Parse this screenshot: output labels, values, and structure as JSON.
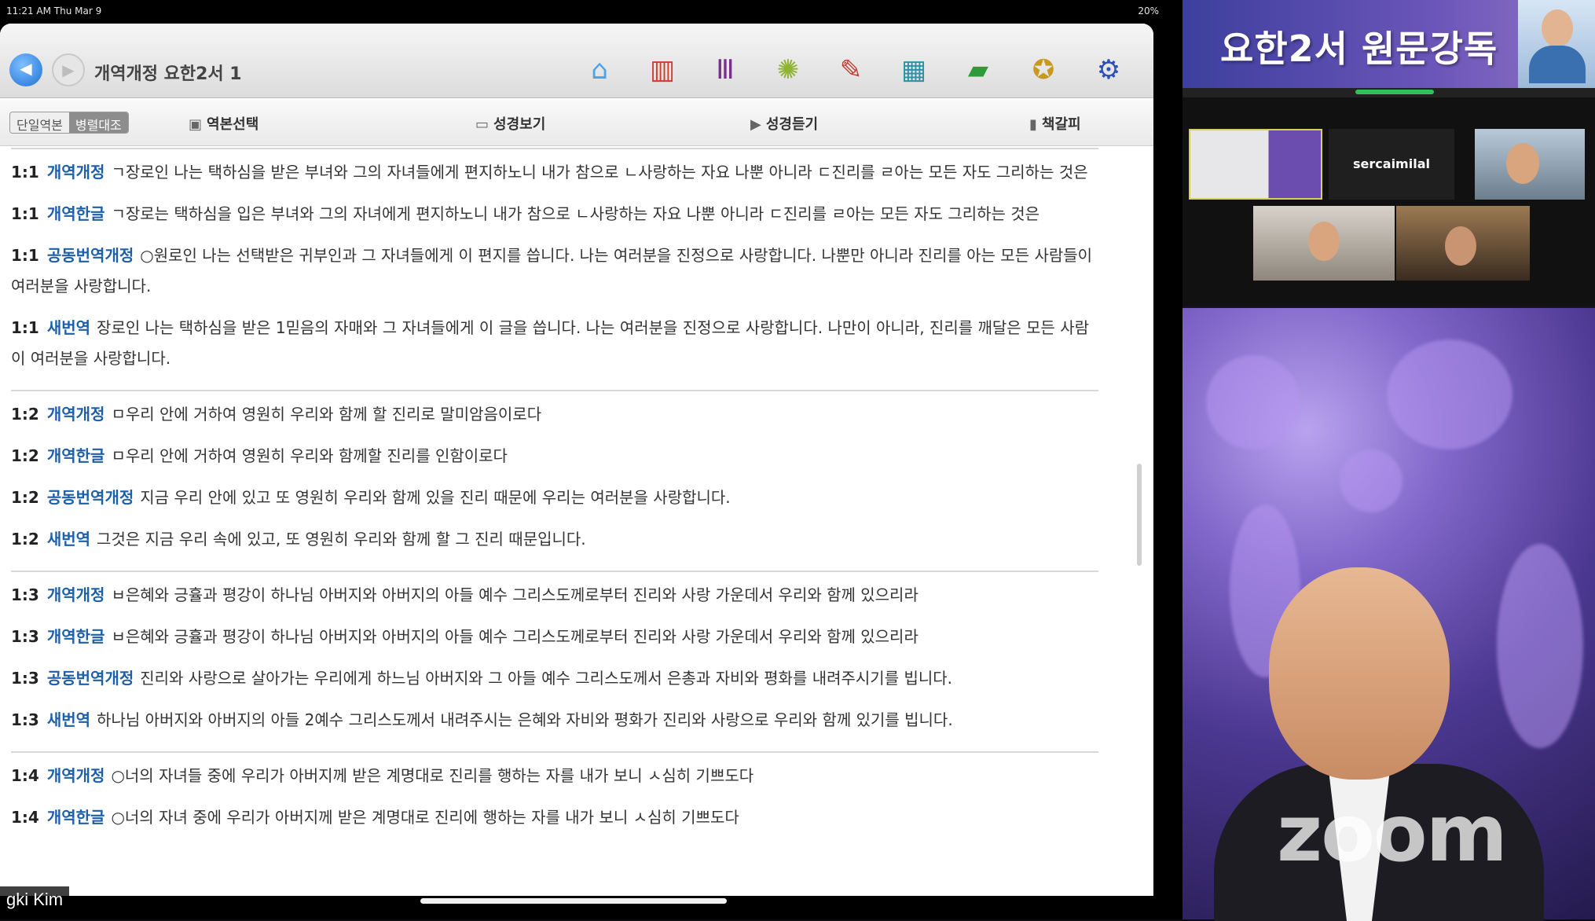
{
  "status_bar": {
    "time": "11:21 AM  Thu Mar 9",
    "right": "20%"
  },
  "app": {
    "title": "개역개정 요한2서 1",
    "toolbar_icons": [
      "home-icon",
      "bible-book-icon",
      "library-icon",
      "star-burst-icon",
      "dove-icon",
      "gallery-icon",
      "notebook-icon",
      "hymn-icon",
      "gear-icon"
    ],
    "segments": [
      "단일역본",
      "병렬대조"
    ],
    "subbar": {
      "version_select": "역본선택",
      "view_bible": "성경보기",
      "listen_bible": "성경듣기",
      "bookmark": "책갈피"
    }
  },
  "verse_groups": [
    [
      {
        "ref": "1:1",
        "version": "개역개정",
        "text": "ㄱ장로인 나는 택하심을 받은 부녀와 그의 자녀들에게 편지하노니 내가 참으로 ㄴ사랑하는 자요 나뿐 아니라 ㄷ진리를 ㄹ아는 모든 자도 그리하는 것은"
      },
      {
        "ref": "1:1",
        "version": "개역한글",
        "text": "ㄱ장로는 택하심을 입은 부녀와 그의 자녀에게 편지하노니 내가 참으로 ㄴ사랑하는 자요 나뿐 아니라 ㄷ진리를 ㄹ아는 모든 자도 그리하는 것은"
      },
      {
        "ref": "1:1",
        "version": "공동번역개정",
        "text": "○원로인 나는 선택받은 귀부인과 그 자녀들에게 이 편지를 씁니다. 나는 여러분을 진정으로 사랑합니다. 나뿐만 아니라 진리를 아는 모든 사람들이 여러분을 사랑합니다."
      },
      {
        "ref": "1:1",
        "version": "새번역",
        "text": "장로인 나는 택하심을 받은 1믿음의 자매와 그 자녀들에게 이 글을 씁니다. 나는 여러분을 진정으로 사랑합니다. 나만이 아니라, 진리를 깨달은 모든 사람이 여러분을 사랑합니다."
      }
    ],
    [
      {
        "ref": "1:2",
        "version": "개역개정",
        "text": "ㅁ우리 안에 거하여 영원히 우리와 함께 할 진리로 말미암음이로다"
      },
      {
        "ref": "1:2",
        "version": "개역한글",
        "text": "ㅁ우리 안에 거하여 영원히 우리와 함께할 진리를 인함이로다"
      },
      {
        "ref": "1:2",
        "version": "공동번역개정",
        "text": "지금 우리 안에 있고 또 영원히 우리와 함께 있을 진리 때문에 우리는 여러분을 사랑합니다."
      },
      {
        "ref": "1:2",
        "version": "새번역",
        "text": "그것은 지금 우리 속에 있고, 또 영원히 우리와 함께 할 그 진리 때문입니다."
      }
    ],
    [
      {
        "ref": "1:3",
        "version": "개역개정",
        "text": "ㅂ은혜와 긍휼과 평강이 하나님 아버지와 아버지의 아들 예수 그리스도께로부터 진리와 사랑 가운데서 우리와 함께 있으리라"
      },
      {
        "ref": "1:3",
        "version": "개역한글",
        "text": "ㅂ은혜와 긍휼과 평강이 하나님 아버지와 아버지의 아들 예수 그리스도께로부터 진리와 사랑 가운데서 우리와 함께 있으리라"
      },
      {
        "ref": "1:3",
        "version": "공동번역개정",
        "text": "진리와 사랑으로 살아가는 우리에게 하느님 아버지와 그 아들 예수 그리스도께서 은총과 자비와 평화를 내려주시기를 빕니다."
      },
      {
        "ref": "1:3",
        "version": "새번역",
        "text": "하나님 아버지와 아버지의 아들 2예수 그리스도께서 내려주시는 은혜와 자비와 평화가 진리와 사랑으로 우리와 함께 있기를 빕니다."
      }
    ],
    [
      {
        "ref": "1:4",
        "version": "개역개정",
        "text": "○너의 자녀들 중에 우리가 아버지께 받은 계명대로 진리를 행하는 자를 내가 보니 ㅅ심히 기쁘도다"
      },
      {
        "ref": "1:4",
        "version": "개역한글",
        "text": "○너의 자녀 중에 우리가 아버지께 받은 계명대로 진리에 행하는 자를 내가 보니 ㅅ심히 기쁘도다"
      }
    ]
  ],
  "participant_name": "gki Kim",
  "zoom": {
    "banner_title": "요한2서 원문강독",
    "gallery_name_tile": "sercaimilal",
    "logo_text": "zoom",
    "rec_color": "#33c05a"
  }
}
